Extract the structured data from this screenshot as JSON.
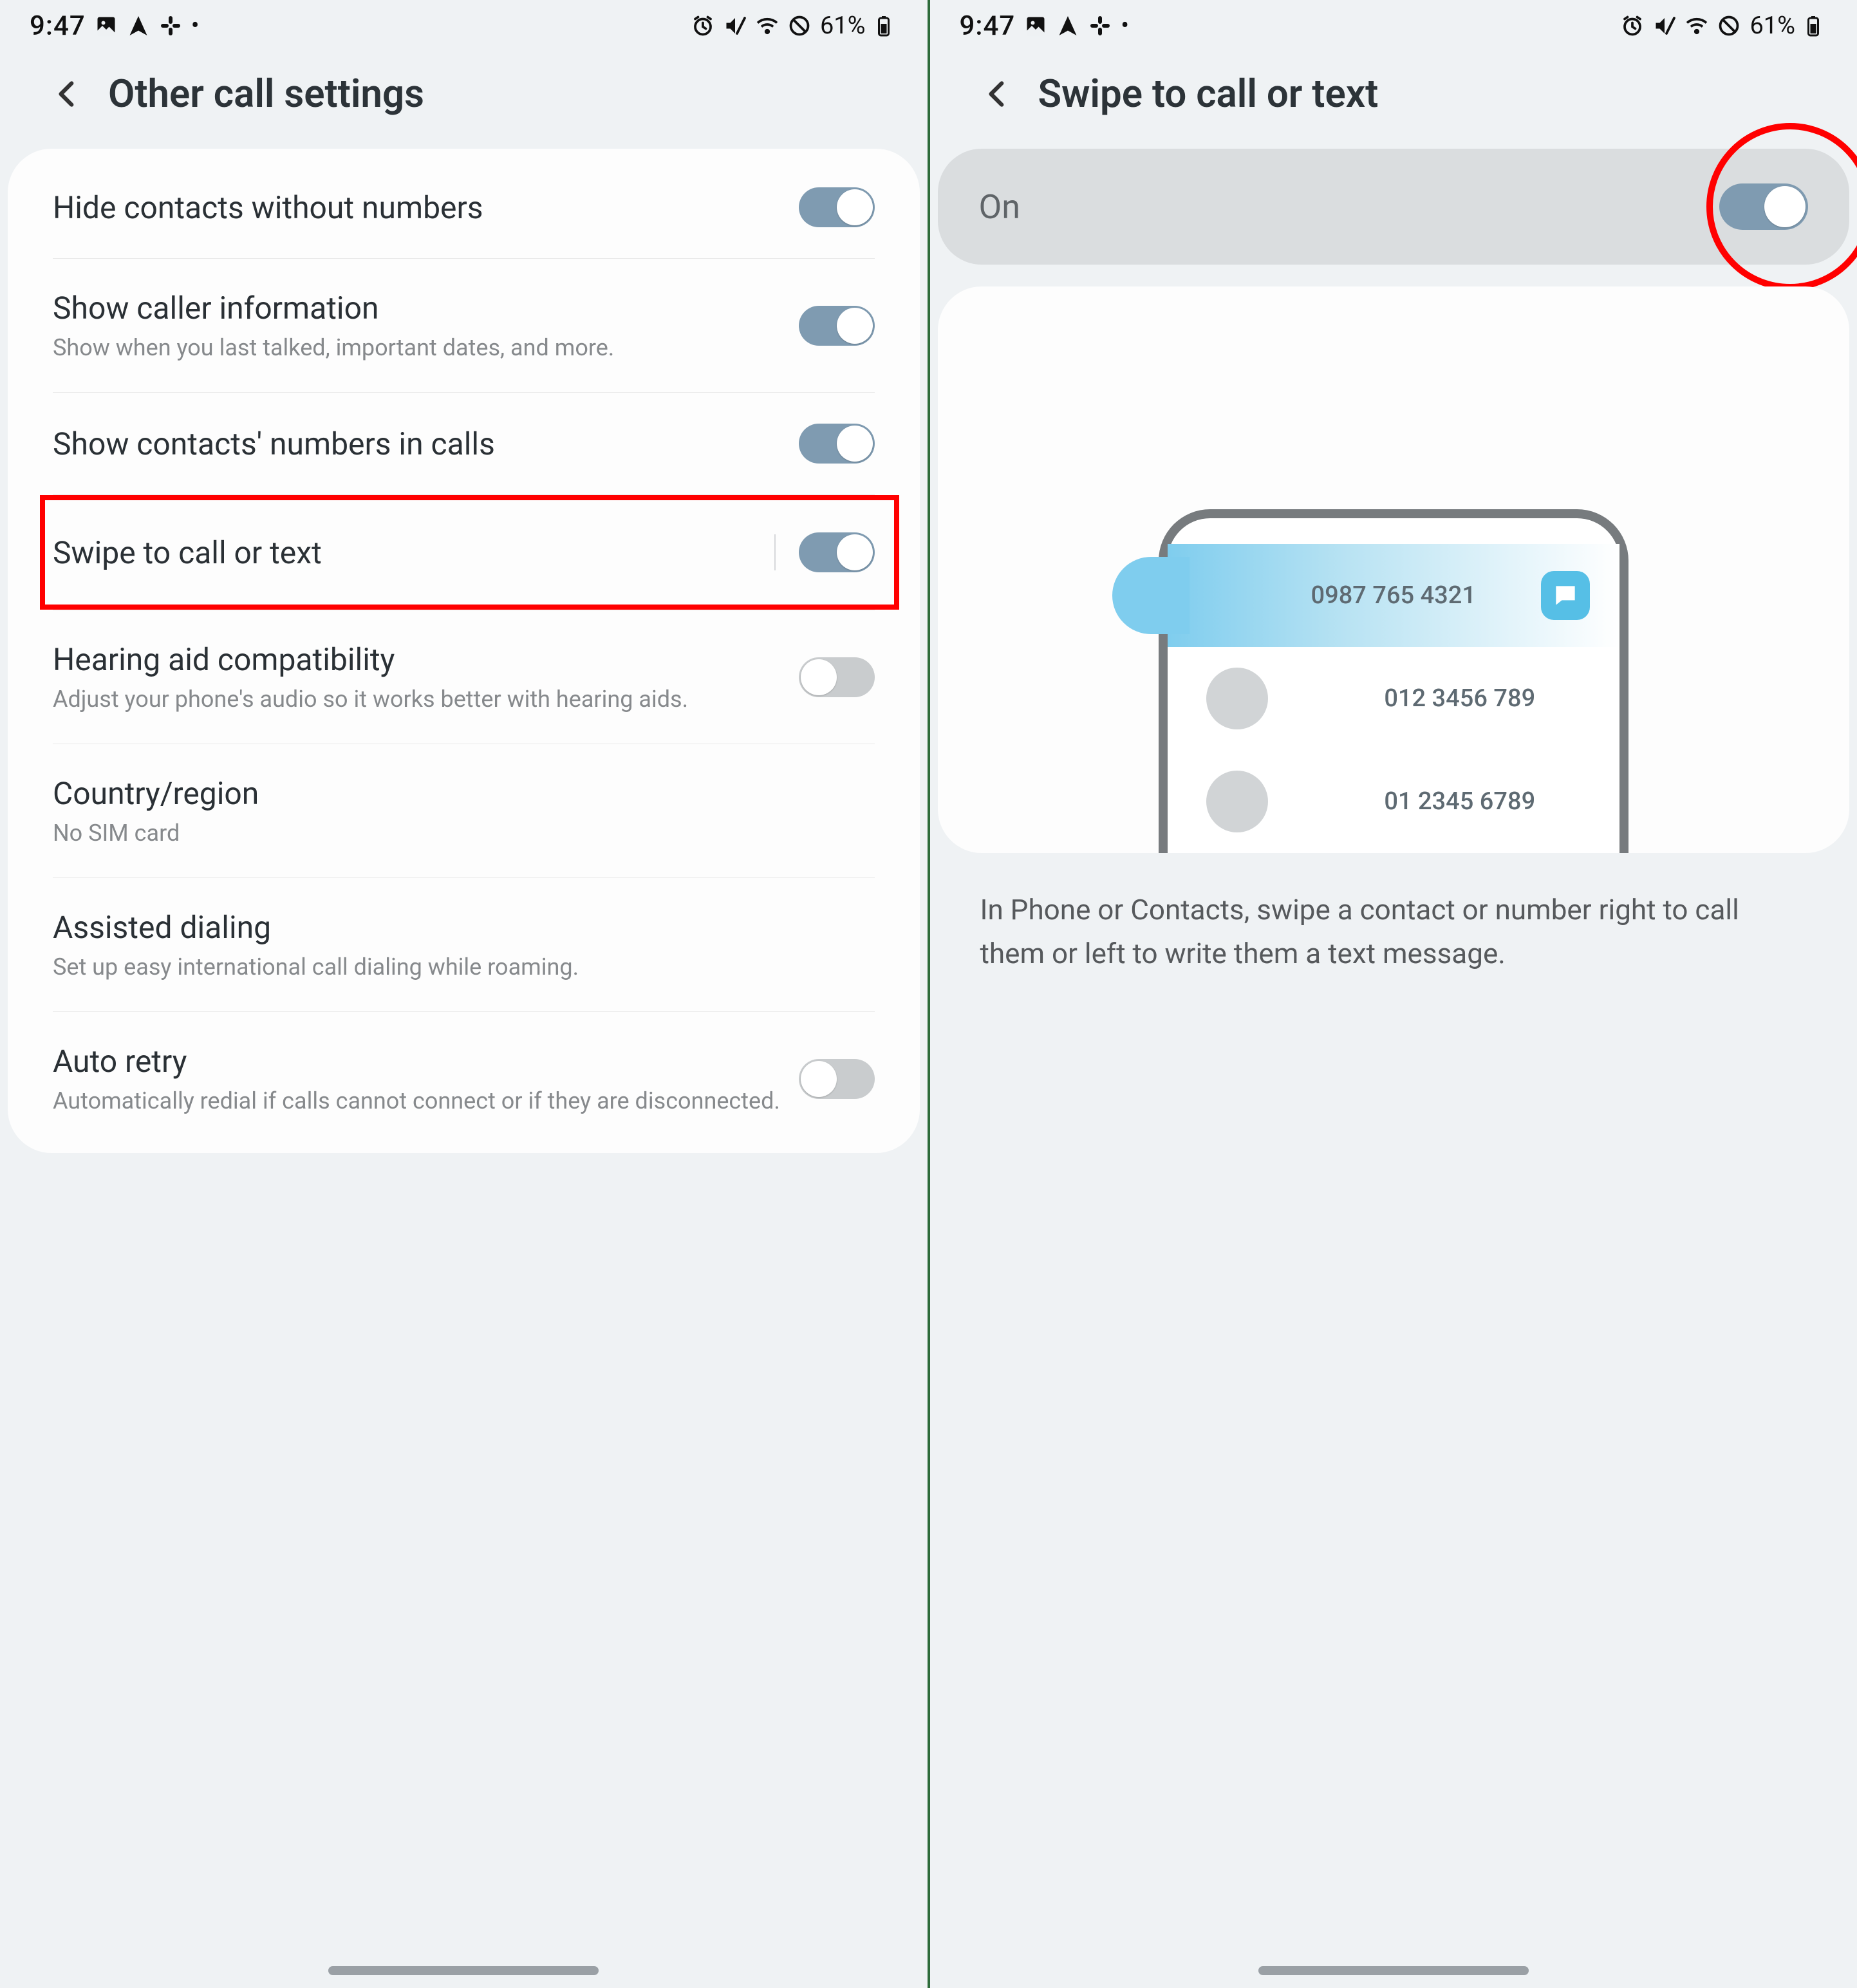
{
  "status": {
    "time": "9:47",
    "battery": "61%"
  },
  "left": {
    "title": "Other call settings",
    "items": [
      {
        "title": "Hide contacts without numbers",
        "sub": "",
        "toggle": "on"
      },
      {
        "title": "Show caller information",
        "sub": "Show when you last talked, important dates, and more.",
        "toggle": "on"
      },
      {
        "title": "Show contacts' numbers in calls",
        "sub": "",
        "toggle": "on"
      },
      {
        "title": "Swipe to call or text",
        "sub": "",
        "toggle": "on"
      },
      {
        "title": "Hearing aid compatibility",
        "sub": "Adjust your phone's audio so it works better with hearing aids.",
        "toggle": "off"
      },
      {
        "title": "Country/region",
        "sub": "No SIM card",
        "toggle": ""
      },
      {
        "title": "Assisted dialing",
        "sub": "Set up easy international call dialing while roaming.",
        "toggle": ""
      },
      {
        "title": "Auto retry",
        "sub": "Automatically redial if calls cannot connect or if they are disconnected.",
        "toggle": "off"
      }
    ]
  },
  "right": {
    "title": "Swipe to call or text",
    "master": "On",
    "preview_numbers": [
      "0987 765 4321",
      "012 3456 789",
      "01 2345 6789"
    ],
    "description": "In Phone or Contacts, swipe a contact or number right to call them or left to write them a text message."
  }
}
